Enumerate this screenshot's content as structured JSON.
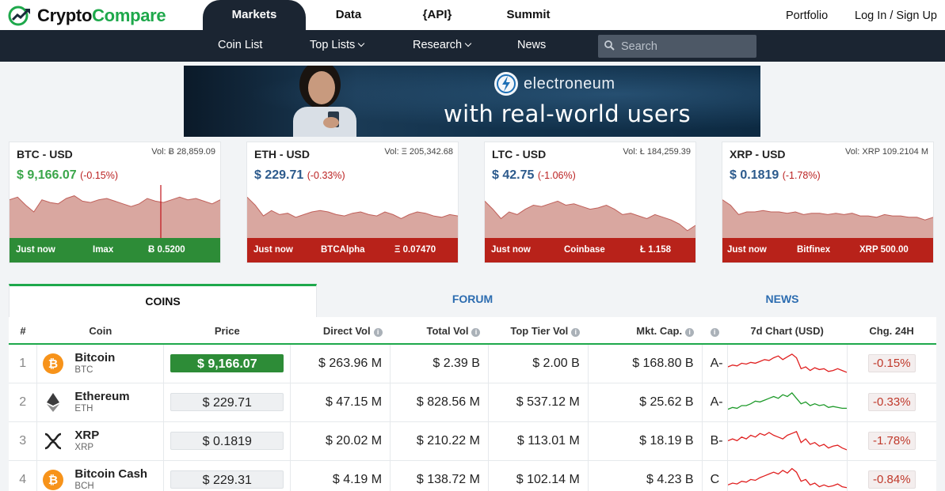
{
  "brand": {
    "part1": "Crypto",
    "part2": "Compare"
  },
  "main_nav": [
    "Markets",
    "Data",
    "{API}",
    "Summit"
  ],
  "top_links": {
    "portfolio": "Portfolio",
    "login": "Log In / Sign Up"
  },
  "sub_nav": {
    "coin_list": "Coin List",
    "top_lists": "Top Lists",
    "research": "Research",
    "news": "News"
  },
  "search": {
    "placeholder": "Search"
  },
  "banner": {
    "brand": "electroneum",
    "tagline": "with real-world users"
  },
  "tickers": [
    {
      "pair": "BTC - USD",
      "vol": "Vol: Ƀ 28,859.09",
      "price": "$ 9,166.07",
      "change": "(-0.15%)",
      "price_color": "#3aa64a",
      "time": "Just now",
      "exchange": "Imax",
      "amount": "Ƀ 0.5200",
      "trend": "up",
      "spark": [
        58,
        62,
        50,
        40,
        58,
        54,
        52,
        60,
        64,
        56,
        54,
        58,
        60,
        56,
        52,
        48,
        52,
        60,
        56,
        54,
        58,
        62,
        58,
        60,
        56,
        52,
        58
      ]
    },
    {
      "pair": "ETH - USD",
      "vol": "Vol: Ξ 205,342.68",
      "price": "$ 229.71",
      "change": "(-0.33%)",
      "price_color": "#2c5a8c",
      "time": "Just now",
      "exchange": "BTCAlpha",
      "amount": "Ξ 0.07470",
      "trend": "down",
      "spark": [
        62,
        50,
        34,
        42,
        36,
        38,
        32,
        36,
        40,
        42,
        40,
        36,
        34,
        38,
        40,
        36,
        34,
        40,
        36,
        30,
        36,
        40,
        38,
        34,
        32,
        36,
        34
      ]
    },
    {
      "pair": "LTC - USD",
      "vol": "Vol: Ł 184,259.39",
      "price": "$ 42.75",
      "change": "(-1.06%)",
      "price_color": "#2c5a8c",
      "time": "Just now",
      "exchange": "Coinbase",
      "amount": "Ł 1.158",
      "trend": "down",
      "spark": [
        56,
        44,
        30,
        40,
        36,
        44,
        50,
        48,
        52,
        56,
        50,
        52,
        48,
        44,
        46,
        50,
        44,
        36,
        38,
        34,
        30,
        36,
        32,
        28,
        22,
        12,
        20
      ]
    },
    {
      "pair": "XRP - USD",
      "vol": "Vol: XRP 109.2104 M",
      "price": "$ 0.1819",
      "change": "(-1.78%)",
      "price_color": "#2c5a8c",
      "time": "Just now",
      "exchange": "Bitfinex",
      "amount": "XRP 500.00",
      "trend": "down",
      "spark": [
        58,
        50,
        36,
        40,
        40,
        42,
        40,
        40,
        38,
        40,
        36,
        38,
        38,
        36,
        38,
        36,
        38,
        34,
        34,
        32,
        36,
        34,
        34,
        32,
        32,
        28,
        32
      ]
    }
  ],
  "tabs": [
    "COINS",
    "FORUM",
    "NEWS"
  ],
  "table": {
    "headers": [
      "#",
      "Coin",
      "Price",
      "Direct Vol",
      "Total Vol",
      "Top Tier Vol",
      "Mkt. Cap.",
      "",
      "7d Chart (USD)",
      "Chg. 24H"
    ],
    "rows": [
      {
        "rank": "1",
        "name": "Bitcoin",
        "symbol": "BTC",
        "price": "$ 9,166.07",
        "direct_vol": "$ 263.96 M",
        "total_vol": "$ 2.39 B",
        "top_tier_vol": "$ 2.00 B",
        "mkt_cap": "$ 168.80 B",
        "grade": "A-",
        "change": "-0.15%",
        "icon": "bitcoin-icon",
        "icon_color": "#f7931a",
        "chart_color": "#e02020",
        "chart": [
          20,
          18,
          19,
          16,
          17,
          15,
          16,
          14,
          12,
          13,
          10,
          8,
          12,
          9,
          6,
          10,
          22,
          20,
          24,
          21,
          23,
          22,
          25,
          24,
          22,
          24,
          26
        ]
      },
      {
        "rank": "2",
        "name": "Ethereum",
        "symbol": "ETH",
        "price": "$ 229.71",
        "direct_vol": "$ 47.15 M",
        "total_vol": "$ 828.56 M",
        "top_tier_vol": "$ 537.12 M",
        "mkt_cap": "$ 25.62 B",
        "grade": "A-",
        "change": "-0.33%",
        "icon": "ethereum-icon",
        "icon_color": "#3c3c3d",
        "chart_color": "#1e9a2a",
        "chart": [
          24,
          22,
          23,
          20,
          20,
          18,
          15,
          16,
          14,
          12,
          10,
          12,
          8,
          10,
          6,
          12,
          18,
          16,
          20,
          18,
          20,
          19,
          22,
          21,
          22,
          23,
          23
        ]
      },
      {
        "rank": "3",
        "name": "XRP",
        "symbol": "XRP",
        "price": "$ 0.1819",
        "direct_vol": "$ 20.02 M",
        "total_vol": "$ 210.22 M",
        "top_tier_vol": "$ 113.01 M",
        "mkt_cap": "$ 18.19 B",
        "grade": "B-",
        "change": "-1.78%",
        "icon": "xrp-icon",
        "icon_color": "#222222",
        "chart_color": "#e02020",
        "chart": [
          16,
          14,
          16,
          12,
          14,
          10,
          12,
          8,
          10,
          7,
          10,
          12,
          14,
          10,
          8,
          6,
          18,
          14,
          20,
          18,
          22,
          20,
          24,
          22,
          21,
          24,
          26
        ]
      },
      {
        "rank": "4",
        "name": "Bitcoin Cash",
        "symbol": "BCH",
        "price": "$ 229.31",
        "direct_vol": "$ 4.19 M",
        "total_vol": "$ 138.72 M",
        "top_tier_vol": "$ 102.14 M",
        "mkt_cap": "$ 4.23 B",
        "grade": "C",
        "change": "-0.84%",
        "icon": "bitcoin-cash-icon",
        "icon_color": "#f7931a",
        "chart_color": "#e02020",
        "chart": [
          22,
          20,
          21,
          18,
          19,
          16,
          17,
          14,
          12,
          10,
          8,
          10,
          6,
          9,
          4,
          8,
          18,
          16,
          22,
          20,
          24,
          22,
          24,
          23,
          21,
          24,
          25
        ]
      }
    ]
  }
}
